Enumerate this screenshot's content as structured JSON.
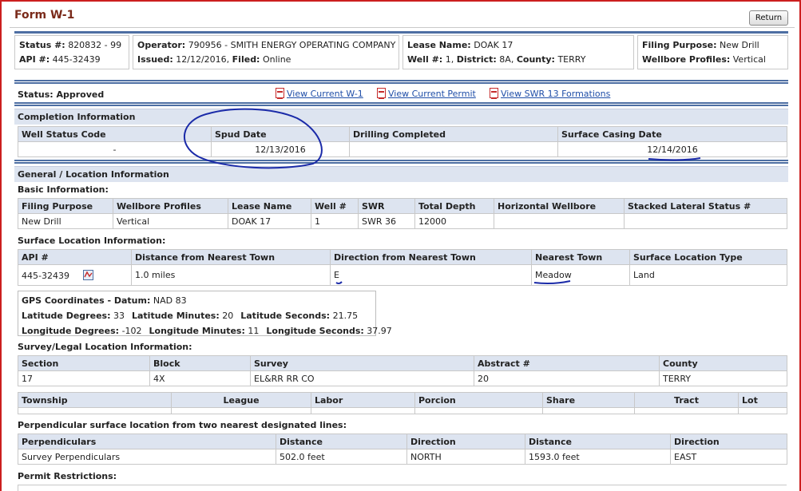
{
  "page": {
    "title": "Form W-1",
    "return_label": "Return"
  },
  "header": {
    "status_label": "Status #:",
    "status_value": "820832 - 99",
    "api_label": "API #:",
    "api_value": "445-32439",
    "operator_label": "Operator:",
    "operator_value": "790956 - SMITH ENERGY OPERATING COMPANY",
    "issued_label": "Issued:",
    "issued_value": "12/12/2016",
    "filed_label": "Filed:",
    "filed_value": "Online",
    "lease_label": "Lease Name:",
    "lease_value": "DOAK 17",
    "well_label": "Well #:",
    "well_value": "1",
    "district_label": "District:",
    "district_value": "8A",
    "county_label": "County:",
    "county_value": "TERRY",
    "purpose_label": "Filing Purpose:",
    "purpose_value": "New Drill",
    "profiles_label": "Wellbore Profiles:",
    "profiles_value": "Vertical"
  },
  "status_bar": {
    "status_text": "Status: Approved",
    "links": [
      "View Current W-1",
      "View Current Permit",
      "View SWR 13 Formations"
    ]
  },
  "completion": {
    "section_title": "Completion Information",
    "headers": [
      "Well Status Code",
      "Spud Date",
      "Drilling Completed",
      "Surface Casing Date"
    ],
    "values": [
      "-",
      "12/13/2016",
      "",
      "12/14/2016"
    ]
  },
  "general": {
    "section_title": "General / Location Information",
    "basic_title": "Basic Information:",
    "basic_headers": [
      "Filing Purpose",
      "Wellbore Profiles",
      "Lease Name",
      "Well #",
      "SWR",
      "Total Depth",
      "Horizontal Wellbore",
      "Stacked Lateral Status #"
    ],
    "basic_values": [
      "New Drill",
      "Vertical",
      "DOAK 17",
      "1",
      "SWR 36",
      "12000",
      "",
      ""
    ],
    "surface_title": "Surface Location Information:",
    "surface_headers": [
      "API #",
      "Distance from Nearest Town",
      "Direction from Nearest Town",
      "Nearest Town",
      "Surface Location Type"
    ],
    "surface_values": [
      "445-32439",
      "1.0 miles",
      "E",
      "Meadow",
      "Land"
    ],
    "map_icon": "map-icon"
  },
  "gps": {
    "datum_label": "GPS Coordinates - Datum:",
    "datum_value": "NAD 83",
    "lat_deg_label": "Latitude Degrees:",
    "lat_deg": "33",
    "lat_min_label": "Latitude Minutes:",
    "lat_min": "20",
    "lat_sec_label": "Latitude Seconds:",
    "lat_sec": "21.75",
    "lon_deg_label": "Longitude Degrees:",
    "lon_deg": "-102",
    "lon_min_label": "Longitude Minutes:",
    "lon_min": "11",
    "lon_sec_label": "Longitude Seconds:",
    "lon_sec": "37.97"
  },
  "survey": {
    "title": "Survey/Legal Location Information:",
    "headers": [
      "Section",
      "Block",
      "Survey",
      "Abstract #",
      "County"
    ],
    "values": [
      "17",
      "4X",
      "EL&RR RR CO",
      "20",
      "TERRY"
    ],
    "headers2": [
      "Township",
      "League",
      "Labor",
      "Porcion",
      "Share",
      "Tract",
      "Lot"
    ],
    "values2": [
      "",
      "",
      "",
      "",
      "",
      "",
      ""
    ]
  },
  "perpendicular": {
    "title": "Perpendicular surface location from two nearest designated lines:",
    "headers": [
      "Perpendiculars",
      "Distance",
      "Direction",
      "Distance",
      "Direction"
    ],
    "values": [
      "Survey Perpendiculars",
      "502.0 feet",
      "NORTH",
      "1593.0 feet",
      "EAST"
    ]
  },
  "restrictions": {
    "title": "Permit Restrictions:"
  },
  "colors": {
    "frame": "#cc1f1f",
    "header_band": "#dde4f0",
    "rule": "#4e6fa3",
    "link": "#1f4ea8",
    "ink": "#1a2aa8"
  }
}
